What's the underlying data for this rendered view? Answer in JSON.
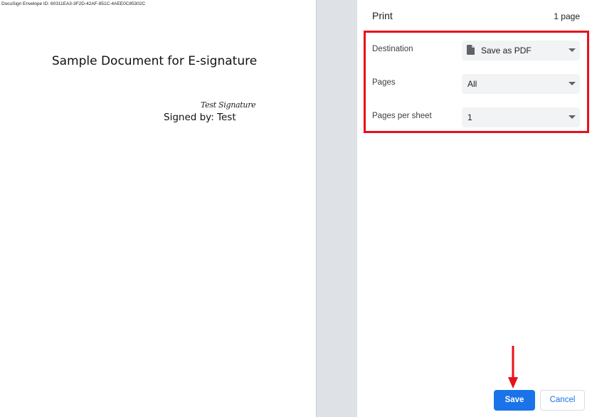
{
  "document": {
    "envelope_id": "DocuSign Envelope ID: 60311EA3-3F2D-42AF-851C-4AEE0C85302C",
    "title": "Sample Document for E-signature",
    "signature_image_text": "Test Signature",
    "signed_by": "Signed by: Test"
  },
  "print_panel": {
    "title": "Print",
    "page_count": "1 page",
    "settings": [
      {
        "label": "Destination",
        "value": "Save as PDF",
        "icon": "file-icon"
      },
      {
        "label": "Pages",
        "value": "All"
      },
      {
        "label": "Pages per sheet",
        "value": "1"
      }
    ],
    "save_label": "Save",
    "cancel_label": "Cancel"
  },
  "colors": {
    "accent": "#1a73e8",
    "highlight": "#e8101a",
    "gutter": "#dee1e6",
    "select_bg": "#f1f3f4"
  }
}
